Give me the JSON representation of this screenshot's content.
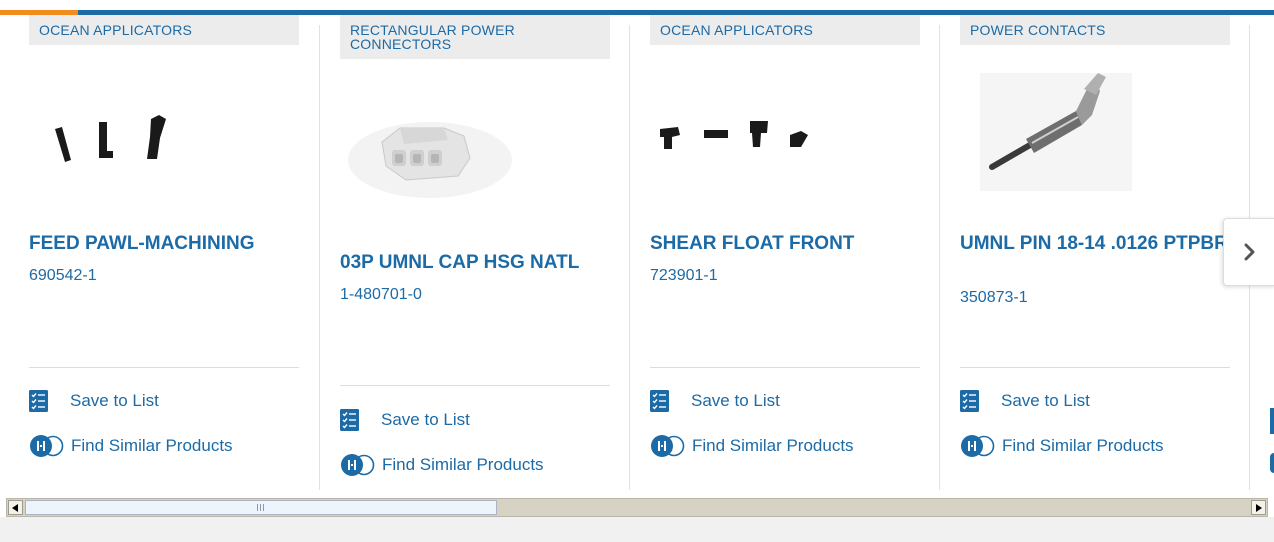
{
  "carousel": {
    "cards": [
      {
        "category": "OCEAN APPLICATORS",
        "title": "FEED PAWL-MACHINING",
        "part_number": "690542-1",
        "save_label": "Save to List",
        "find_label": "Find Similar Products",
        "image": "feed-pawl-parts-image"
      },
      {
        "category": "RECTANGULAR POWER CONNECTORS",
        "title": "03P UMNL CAP HSG NATL",
        "part_number": "1-480701-0",
        "save_label": "Save to List",
        "find_label": "Find Similar Products",
        "image": "white-connector-housing-image"
      },
      {
        "category": "OCEAN APPLICATORS",
        "title": "SHEAR FLOAT FRONT",
        "part_number": "723901-1",
        "save_label": "Save to List",
        "find_label": "Find Similar Products",
        "image": "shear-float-parts-image"
      },
      {
        "category": "POWER CONTACTS",
        "title": "UMNL PIN 18-14 .0126 PTPBR",
        "part_number": "350873-1",
        "save_label": "Save to List",
        "find_label": "Find Similar Products",
        "image": "power-contact-pin-image"
      }
    ],
    "next_icon": "chevron-right-icon"
  },
  "scrollbar": {
    "left_icon": "triangle-left-icon",
    "right_icon": "triangle-right-icon"
  },
  "colors": {
    "brand_blue": "#1c6aa6",
    "accent_orange": "#f28c1d",
    "category_bg": "#ececec"
  }
}
